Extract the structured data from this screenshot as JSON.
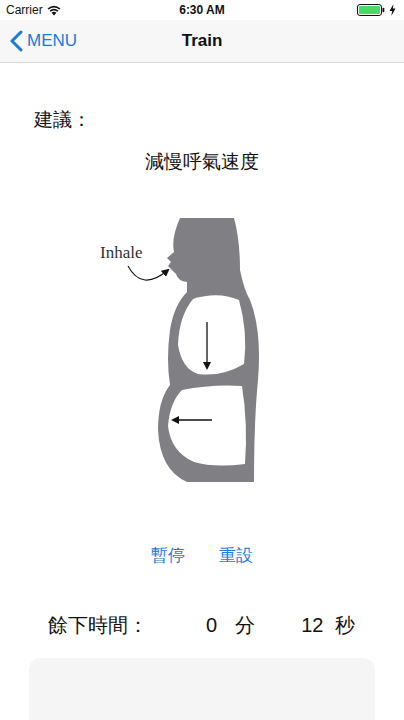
{
  "status_bar": {
    "carrier": "Carrier",
    "time": "6:30 AM",
    "battery": {
      "level": 1,
      "charging": true
    }
  },
  "nav": {
    "back": "MENU",
    "title": "Train"
  },
  "suggestion": {
    "label": "建議：",
    "text": "減慢呼氣速度"
  },
  "figure": {
    "label": "Inhale"
  },
  "buttons": [
    {
      "label": "暫停"
    },
    {
      "label": "重設"
    }
  ],
  "timer": {
    "label": "餘下時間：",
    "minutes": "0",
    "minutes_unit": "分",
    "seconds": "12",
    "seconds_unit": "秒"
  }
}
